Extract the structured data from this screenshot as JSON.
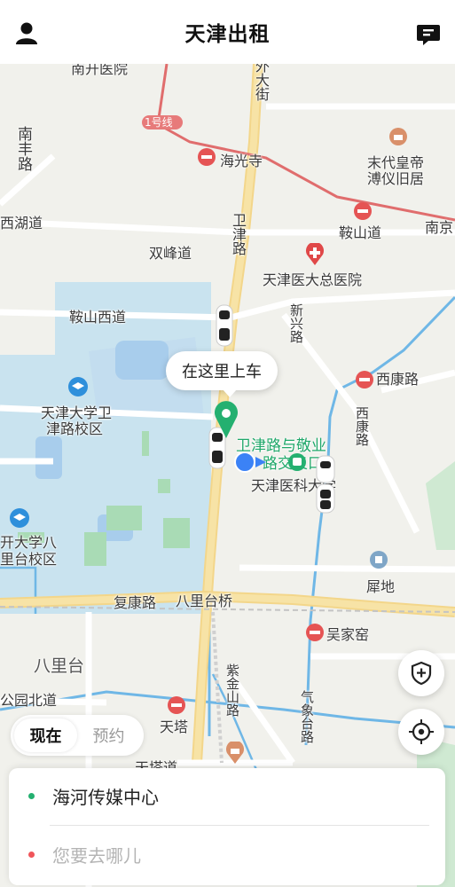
{
  "header": {
    "title": "天津出租",
    "user_icon": "user-icon",
    "message_icon": "message-icon"
  },
  "map": {
    "labels": {
      "nankai_hospital": "南开医院",
      "line1": "1号线",
      "haiguangsi": "海光寺",
      "modai": "末代皇帝",
      "modai2": "溥仪旧居",
      "nanfeng": "南丰路",
      "xihu": "西湖道",
      "shuangfeng": "双峰道",
      "anshan": "鞍山道",
      "nanjing": "南京",
      "tjmu_hospital": "天津医大总医院",
      "anshanxi": "鞍山西道",
      "xinxing": "新兴路",
      "xikang_station": "西康路",
      "tju1": "天津大学卫",
      "tju2": "津路校区",
      "weijin_stop1": "卫津路与敬业",
      "weijin_stop2": "路交叉口",
      "tmu": "天津医科大学",
      "xikang_road": "西康路",
      "nku1": "开大学八",
      "nku2": "里台校区",
      "xidi": "犀地",
      "fukang": "复康路",
      "balitai_bridge": "八里台桥",
      "wujiayao": "吴家窑",
      "balitai": "八里台",
      "gongbei": "公园北道",
      "tianta": "天塔",
      "ziqiao": "紫金山路",
      "qixiangtai": "气象台路",
      "tianta_road": "天塔道",
      "waidajie": "外大街",
      "weijin_road": "卫津路"
    },
    "pickup_bubble": "在这里上车"
  },
  "controls": {
    "safety_icon": "shield-plus-icon",
    "locate_icon": "locate-icon"
  },
  "mode_tabs": {
    "now": "现在",
    "reserve": "预约"
  },
  "trip": {
    "from": "海河传媒中心",
    "to_placeholder": "您要去哪儿"
  },
  "colors": {
    "accent_green": "#24b070",
    "dest_red": "#f0555a",
    "water": "#bfdcef",
    "campus": "#c9e3ef"
  }
}
